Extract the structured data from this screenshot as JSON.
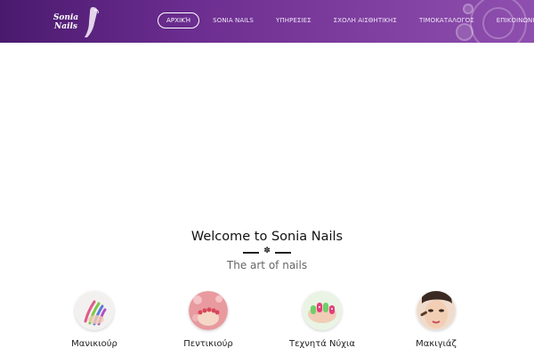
{
  "header": {
    "logo_text": "Sonia Nails",
    "brand_color": "#6b2d8f",
    "nav": [
      {
        "label": "ΑΡΧΙΚΉ",
        "active": true
      },
      {
        "label": "SONIA NAILS",
        "active": false
      },
      {
        "label": "ΥΠΗΡΕΣΙΕΣ",
        "active": false
      },
      {
        "label": "ΣΧΟΛΗ ΑΙΣΘΗΤΙΚΗΣ",
        "active": false
      },
      {
        "label": "ΤΙΜΟΚΑΤΑΛΟΓΟΣ",
        "active": false
      },
      {
        "label": "ΕΠΙΚΟΙΝΩΝΙΑ",
        "active": false
      }
    ]
  },
  "welcome": {
    "title": "Welcome to Sonia Nails",
    "divider_icon": "flower-icon",
    "subtitle": "The art of nails"
  },
  "services": [
    {
      "label": "Μανικιούρ",
      "icon": "manicure-image"
    },
    {
      "label": "Πεντικιούρ",
      "icon": "pedicure-image"
    },
    {
      "label": "Τεχνητά Νύχια",
      "icon": "artificial-nails-image"
    },
    {
      "label": "Μακιγιάζ",
      "icon": "makeup-image"
    }
  ]
}
